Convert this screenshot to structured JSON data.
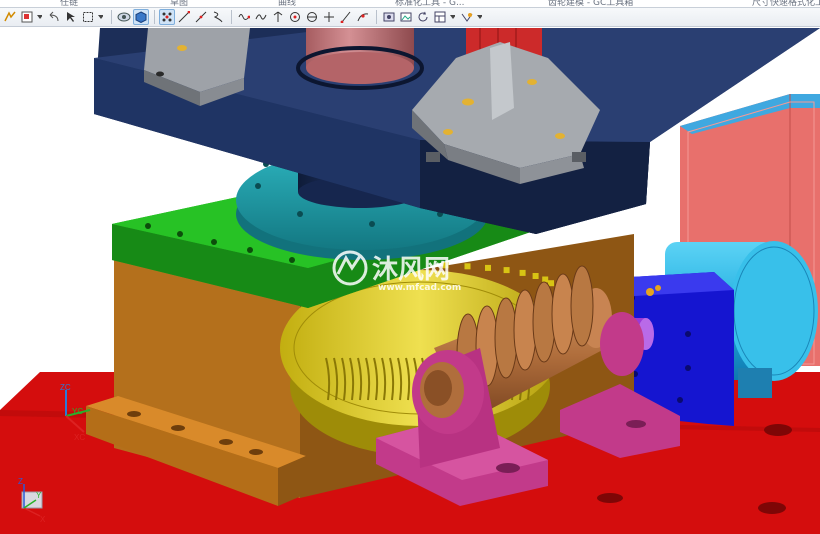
{
  "window": {
    "tabs": [
      "任链",
      "草图",
      "曲线",
      "标准化工具 - G...",
      "齿轮建模 - GC工具箱",
      "尺寸快速格式化工具 - GC..."
    ]
  },
  "toolbar": {
    "icons": [
      "sketch-icon",
      "dropdown-icon",
      "select-filter-icon",
      "undo-icon",
      "box-select-icon",
      "dropdown-icon",
      "rotate-view-icon",
      "shaded-view-icon",
      "snap-grid-icon",
      "line-icon",
      "diagonal-line-icon",
      "curve-icon",
      "spline-icon",
      "wave-curve-icon",
      "vertical-line-icon",
      "circle-point-icon",
      "center-icon",
      "plus-icon",
      "slash-icon",
      "curve-edit-icon",
      "screenshot-icon",
      "image-icon",
      "refresh-icon",
      "layout-icon",
      "dropdown-icon",
      "view-settings-icon",
      "dropdown-icon"
    ]
  },
  "viewport": {
    "watermark": {
      "brand_text": "沐风网",
      "url_text": "www.mfcad.com"
    },
    "axis_labels": {
      "zc": "ZC",
      "yc": "YC",
      "xc": "XC",
      "z": "Z",
      "y": "Y",
      "x": "X"
    },
    "colors": {
      "base_plate": "#d40d0d",
      "gear_housing": "#b4701c",
      "housing_top": "#1fa01c",
      "worm_gear": "#dcc814",
      "worm_shaft": "#b06e3c",
      "bearing_block": "#c23a8a",
      "motor_mount": "#1515d0",
      "motor": "#22aee0",
      "top_frame": "#1c2e58",
      "column": "#c4787a",
      "bracket": "#9ea2a8",
      "flange": "#1f9aa6",
      "side_box": "#e8706c"
    }
  }
}
